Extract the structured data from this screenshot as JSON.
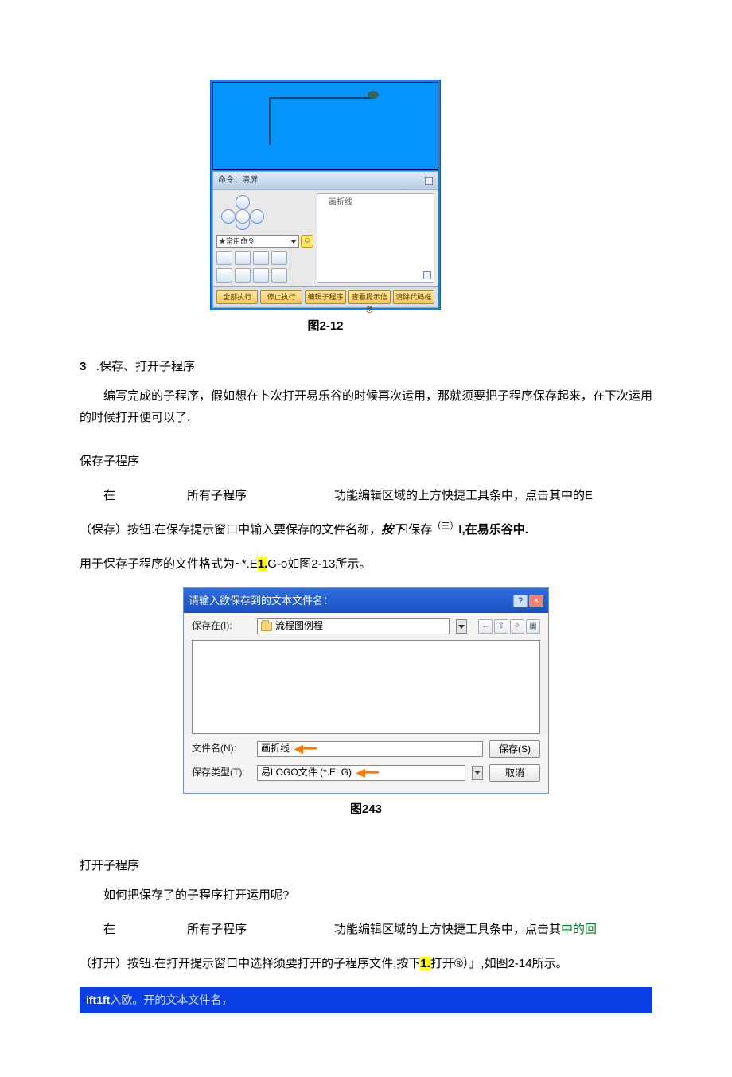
{
  "fig212": {
    "panel_title": "命令：清屏",
    "right_label": "画折线",
    "combo": "★常用命令",
    "buttons": [
      "全部执行",
      "停止执行",
      "编辑子程序",
      "查看提示信息",
      "清除代码框"
    ],
    "caption": "图2-12"
  },
  "section3": {
    "num": "3",
    "heading": ".保存、打开子程序",
    "para": "编写完成的子程序，假如想在卜次打开易乐谷的时候再次运用，那就须要把子程序保存起来，在下次运用的时候打开便可以了."
  },
  "save": {
    "h": "保存子程序",
    "line1_a": "在",
    "line1_b": "所有子程序",
    "line1_c": "功能编辑区域的上方快捷工具条中，点击其中的E",
    "line2_a": "（保存）按钮.在保存提示窗口中输入要保存的文件名称，",
    "line2_b": "按下",
    "line2_c": "I保存",
    "line2_sup": "（三）",
    "line2_d": "I,在易乐谷中.",
    "line3_a": "用于保存子程序的文件格式为~*.E",
    "line3_hl": "1.",
    "line3_b": "G-o如图2-13所示。"
  },
  "dlg": {
    "title": "请输入欲保存到的文本文件名：",
    "savein_lbl": "保存在(I):",
    "folder": "流程图例程",
    "filename_lbl": "文件名(N):",
    "filename_val": "画折线",
    "type_lbl": "保存类型(T):",
    "type_val": "易LOGO文件 (*.ELG)",
    "btn_save": "保存(S)",
    "btn_cancel": "取消",
    "caption": "图243"
  },
  "open": {
    "h": "打开子程序",
    "q": "如何把保存了的子程序打开运用呢?",
    "line1_a": "在",
    "line1_b": "所有子程序",
    "line1_c": "功能编辑区域的上方快捷工具条中，点击其",
    "line1_green": "中的回",
    "line2_a": "（打开）按钮.在打开提示窗口中选择须要打开的子程序文件,按下",
    "line2_hl": "1.",
    "line2_b": "打开®）」,如图2-14所示。"
  },
  "strip": {
    "bold": "ift1ft",
    "rest": "入欧。开的文本文件名，"
  }
}
